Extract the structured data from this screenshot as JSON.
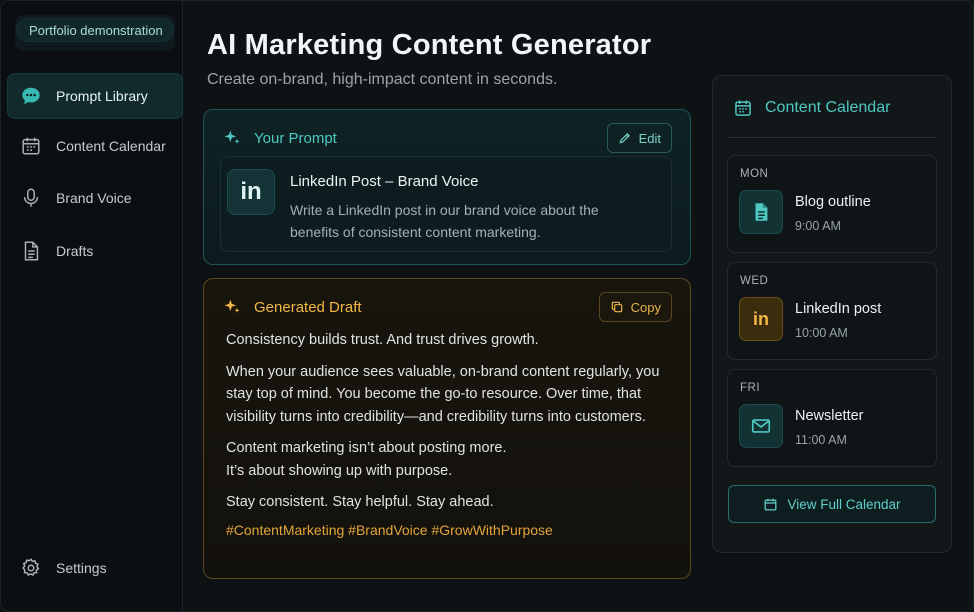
{
  "badge": "Portfolio demonstration",
  "sidebar": {
    "items": [
      {
        "label": "Prompt Library",
        "icon": "chat-bubble-icon",
        "active": true
      },
      {
        "label": "Content Calendar",
        "icon": "calendar-icon",
        "active": false
      },
      {
        "label": "Brand Voice",
        "icon": "microphone-icon",
        "active": false
      },
      {
        "label": "Drafts",
        "icon": "document-icon",
        "active": false
      }
    ],
    "settings_label": "Settings"
  },
  "header": {
    "title": "AI Marketing Content Generator",
    "subtitle": "Create on-brand, high-impact content in seconds."
  },
  "prompt": {
    "heading": "Your Prompt",
    "edit_label": "Edit",
    "logo_text": "in",
    "name": "LinkedIn Post – Brand Voice",
    "description": "Write a LinkedIn post in our brand voice about the benefits of consistent content marketing."
  },
  "draft": {
    "heading": "Generated Draft",
    "copy_label": "Copy",
    "paragraphs": [
      "Consistency builds trust. And trust drives growth.",
      "When your audience sees valuable, on-brand content regularly, you stay top of mind. You become the go-to resource. Over time, that visibility turns into credibility—and credibility turns into customers.",
      "Content marketing isn’t about posting more. It’s about showing up with purpose.",
      "Stay consistent. Stay helpful. Stay ahead."
    ],
    "hashtags": "#ContentMarketing #BrandVoice #GrowWithPurpose"
  },
  "calendar": {
    "heading": "Content Calendar",
    "items": [
      {
        "day": "MON",
        "title": "Blog outline",
        "time": "9:00 AM",
        "icon": "document-icon"
      },
      {
        "day": "WED",
        "title": "LinkedIn post",
        "time": "10:00 AM",
        "icon": "linkedin-icon"
      },
      {
        "day": "FRI",
        "title": "Newsletter",
        "time": "11:00 AM",
        "icon": "mail-icon"
      }
    ],
    "view_full_label": "View Full Calendar"
  },
  "colors": {
    "accent_teal": "#4fc8c2",
    "accent_gold": "#f2b843",
    "background": "#0e1215"
  }
}
